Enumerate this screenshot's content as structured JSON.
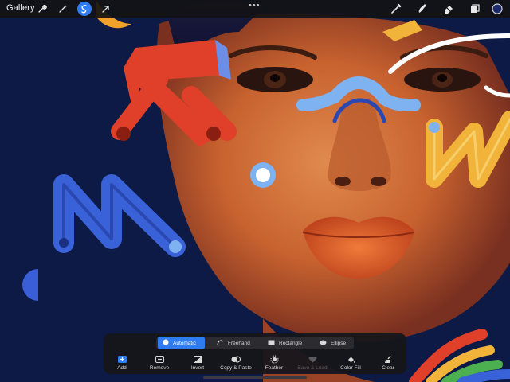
{
  "topbar": {
    "gallery_label": "Gallery",
    "more_label": "•••",
    "left_tools": [
      {
        "name": "wrench-icon"
      },
      {
        "name": "magic-wand-icon"
      },
      {
        "name": "selection-icon",
        "active": true
      },
      {
        "name": "transform-arrow-icon"
      }
    ],
    "right_tools": [
      {
        "name": "brush-icon"
      },
      {
        "name": "smudge-icon"
      },
      {
        "name": "eraser-icon"
      },
      {
        "name": "layers-icon"
      },
      {
        "name": "color-swatch-icon"
      }
    ]
  },
  "selection_panel": {
    "modes": [
      {
        "label": "Automatic",
        "icon": "automatic-icon",
        "active": true
      },
      {
        "label": "Freehand",
        "icon": "freehand-icon",
        "active": false
      },
      {
        "label": "Rectangle",
        "icon": "rectangle-icon",
        "active": false
      },
      {
        "label": "Ellipse",
        "icon": "ellipse-icon",
        "active": false
      }
    ],
    "tools": [
      {
        "label": "Add",
        "icon": "add-icon",
        "enabled": true
      },
      {
        "label": "Remove",
        "icon": "remove-icon",
        "enabled": true
      },
      {
        "label": "Invert",
        "icon": "invert-icon",
        "enabled": true
      },
      {
        "label": "Copy & Paste",
        "icon": "copy-paste-icon",
        "enabled": true
      },
      {
        "label": "Feather",
        "icon": "feather-icon",
        "enabled": true
      },
      {
        "label": "Save & Load",
        "icon": "save-load-icon",
        "enabled": false
      },
      {
        "label": "Color Fill",
        "icon": "color-fill-icon",
        "enabled": true
      },
      {
        "label": "Clear",
        "icon": "clear-icon",
        "enabled": true
      }
    ]
  },
  "colors": {
    "accent": "#2f7bf0",
    "toolbar_bg": "#121216",
    "canvas_bg": "#0c1a45",
    "shape_red": "#e0402a",
    "shape_blue": "#3a62d8",
    "shape_light_blue": "#7fb2f0",
    "shape_yellow": "#f2b33a"
  }
}
